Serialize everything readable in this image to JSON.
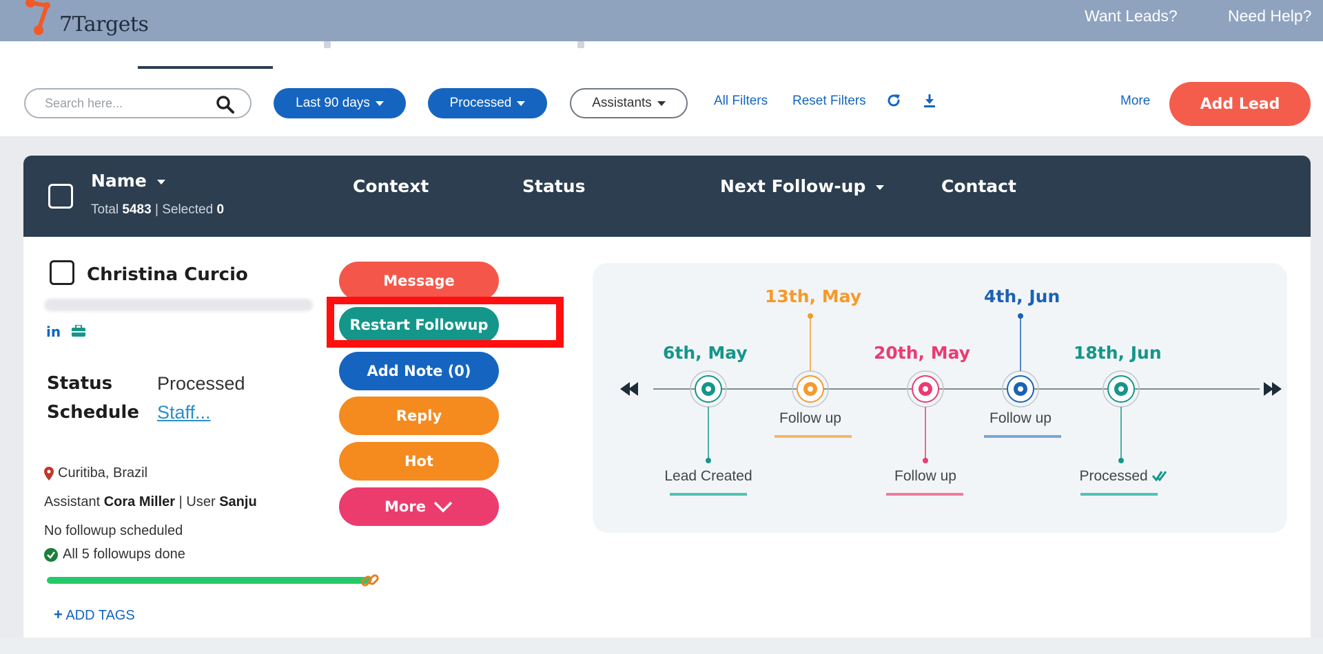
{
  "app": {
    "name": "7Targets",
    "top_links": [
      "Want Leads?",
      "Need Help?"
    ]
  },
  "filters": {
    "search_placeholder": "Search here...",
    "date_range": "Last 90 days",
    "status": "Processed",
    "assistants": "Assistants",
    "all_filters": "All Filters",
    "reset_filters": "Reset Filters",
    "more": "More",
    "add_lead": "Add Lead"
  },
  "table_header": {
    "name": "Name",
    "total_label": "Total",
    "total": "5483",
    "selected_label": "Selected",
    "selected": "0",
    "context": "Context",
    "status": "Status",
    "next_followup": "Next Follow-up",
    "contact": "Contact"
  },
  "lead": {
    "name": "Christina Curcio",
    "linkedin": "in",
    "status_label": "Status",
    "status": "Processed",
    "schedule_label": "Schedule",
    "schedule": "Staff...",
    "location": "Curitiba, Brazil",
    "assistant_label": "Assistant",
    "assistant": "Cora Miller",
    "user_label": "User",
    "user": "Sanju",
    "followup_note": "No followup scheduled",
    "followups_done": "All 5 followups done",
    "followup_progress": 1.0,
    "add_tags": "ADD TAGS"
  },
  "actions": {
    "message": "Message",
    "restart_followup": "Restart Followup",
    "add_note": "Add Note (0)",
    "reply": "Reply",
    "hot": "Hot",
    "more": "More"
  },
  "timeline": {
    "events": [
      {
        "date": "6th, May",
        "label": "Lead Created",
        "color": "#14968a"
      },
      {
        "date": "13th, May",
        "label": "Follow up",
        "color": "#f59a2b"
      },
      {
        "date": "20th, May",
        "label": "Follow up",
        "color": "#ea3c71"
      },
      {
        "date": "4th, Jun",
        "label": "Follow up",
        "color": "#1a62b5"
      },
      {
        "date": "18th, Jun",
        "label": "Processed",
        "color": "#14968a"
      }
    ]
  },
  "colors": {
    "topbar": "#8fa3bf",
    "header": "#2c3e50",
    "primary_blue": "#1565c0",
    "add_lead": "#f45d4c",
    "highlight": "#ff0f0f"
  }
}
